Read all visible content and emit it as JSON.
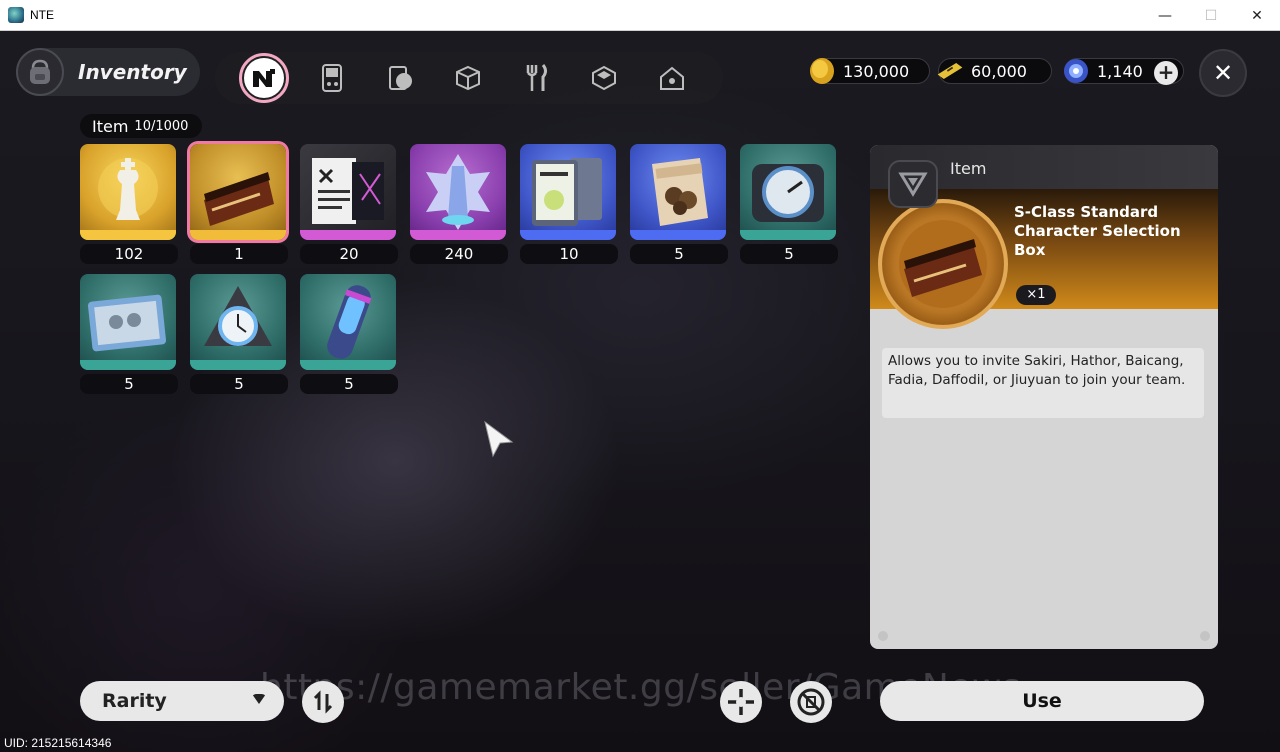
{
  "window": {
    "title": "NTE",
    "minimize": "—",
    "maximize": "☐",
    "close": "✕"
  },
  "header": {
    "section_label": "Inventory",
    "tabs": [
      {
        "icon": "nte-logo-icon",
        "active": true
      },
      {
        "icon": "handheld-console-icon"
      },
      {
        "icon": "phone-card-icon"
      },
      {
        "icon": "box-icon"
      },
      {
        "icon": "fork-knife-icon"
      },
      {
        "icon": "crate-icon"
      },
      {
        "icon": "house-icon"
      }
    ],
    "currencies": [
      {
        "icon": "gold-coin-icon",
        "value": "130,000"
      },
      {
        "icon": "ticket-icon",
        "value": "60,000"
      },
      {
        "icon": "crystal-icon",
        "value": "1,140"
      }
    ],
    "add_label": "+",
    "close_label": "✕"
  },
  "item_count": {
    "label": "Item",
    "value": "10/1000"
  },
  "items": [
    {
      "qty": "102",
      "rarity": "gold"
    },
    {
      "qty": "1",
      "rarity": "gold",
      "selected": true
    },
    {
      "qty": "20",
      "rarity": "purple"
    },
    {
      "qty": "240",
      "rarity": "purple"
    },
    {
      "qty": "10",
      "rarity": "blue"
    },
    {
      "qty": "5",
      "rarity": "blue"
    },
    {
      "qty": "5",
      "rarity": "teal"
    },
    {
      "qty": "5",
      "rarity": "teal"
    },
    {
      "qty": "5",
      "rarity": "teal"
    },
    {
      "qty": "5",
      "rarity": "teal"
    }
  ],
  "detail": {
    "category": "Item",
    "name": "S-Class Standard Character Selection Box",
    "quantity": "×1",
    "description": "Allows you to invite Sakiri, Hathor, Baicang, Fadia, Daffodil, or Jiuyuan to join your team."
  },
  "footer": {
    "sort_label": "Rarity",
    "use_label": "Use",
    "watermark": "https://gamemarket.gg/seller/GameNews",
    "uid": "UID: 215215614346"
  },
  "colors": {
    "gold": "#f5c540",
    "purple": "#d25bd5",
    "blue": "#4d6cf2",
    "teal": "#3aa596",
    "selected": "#f07aa2"
  }
}
